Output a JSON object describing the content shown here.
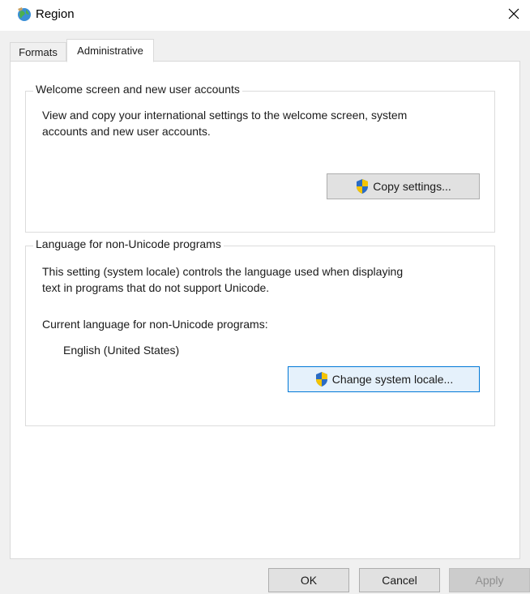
{
  "window": {
    "title": "Region",
    "icon": "globe-region-icon",
    "close_icon": "close-icon"
  },
  "tabs": [
    {
      "label": "Formats",
      "selected": false
    },
    {
      "label": "Administrative",
      "selected": true
    }
  ],
  "welcome": {
    "legend": "Welcome screen and new user accounts",
    "line1": "View and copy your international settings to the welcome screen, system",
    "line2": "accounts and new user accounts.",
    "button": "Copy settings..."
  },
  "language": {
    "legend": "Language for non-Unicode programs",
    "line1": "This setting (system locale) controls the language used when displaying",
    "line2": "text in programs that do not support Unicode.",
    "current_label": "Current language for non-Unicode programs:",
    "current_value": "English (United States)",
    "button": "Change system locale..."
  },
  "footer": {
    "ok": "OK",
    "cancel": "Cancel",
    "apply": "Apply",
    "apply_enabled": false
  },
  "colors": {
    "shield_blue": "#2b6cc4",
    "shield_yellow": "#f5c400",
    "focus_border": "#0078d7"
  }
}
